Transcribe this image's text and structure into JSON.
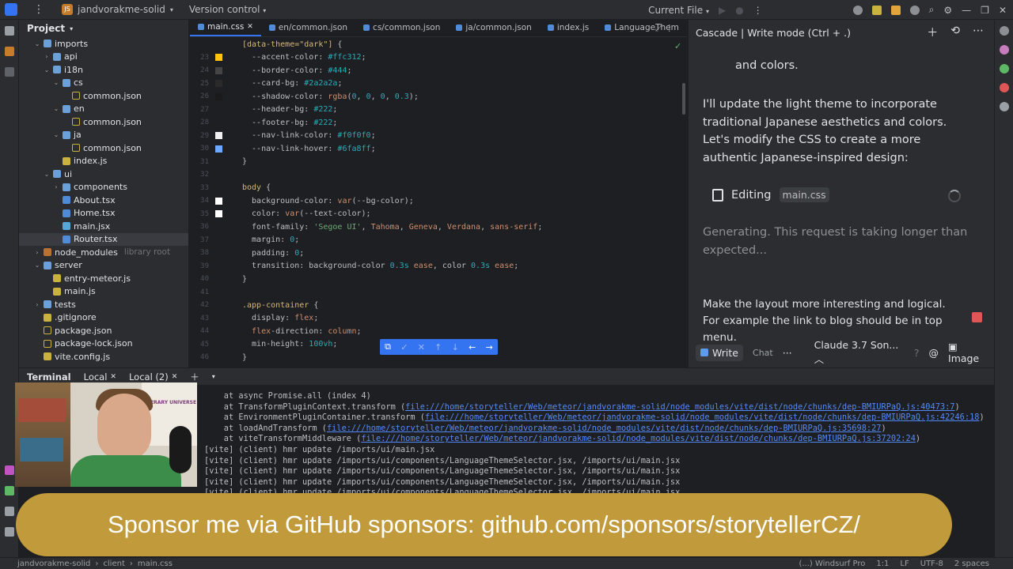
{
  "titlebar": {
    "project_name": "jandvorakme-solid",
    "version_control": "Version control",
    "current_file": "Current File"
  },
  "project_panel": {
    "title": "Project",
    "items": [
      {
        "label": "imports",
        "indent": 0,
        "kind": "folder",
        "open": true
      },
      {
        "label": "api",
        "indent": 1,
        "kind": "folder",
        "open": false
      },
      {
        "label": "i18n",
        "indent": 1,
        "kind": "folder",
        "open": true
      },
      {
        "label": "cs",
        "indent": 2,
        "kind": "folder",
        "open": true
      },
      {
        "label": "common.json",
        "indent": 3,
        "kind": "json"
      },
      {
        "label": "en",
        "indent": 2,
        "kind": "folder",
        "open": true
      },
      {
        "label": "common.json",
        "indent": 3,
        "kind": "json"
      },
      {
        "label": "ja",
        "indent": 2,
        "kind": "folder",
        "open": true
      },
      {
        "label": "common.json",
        "indent": 3,
        "kind": "json"
      },
      {
        "label": "index.js",
        "indent": 2,
        "kind": "js"
      },
      {
        "label": "ui",
        "indent": 1,
        "kind": "folder",
        "open": true
      },
      {
        "label": "components",
        "indent": 2,
        "kind": "folder",
        "open": false
      },
      {
        "label": "About.tsx",
        "indent": 2,
        "kind": "tsx"
      },
      {
        "label": "Home.tsx",
        "indent": 2,
        "kind": "tsx"
      },
      {
        "label": "main.jsx",
        "indent": 2,
        "kind": "jsx"
      },
      {
        "label": "Router.tsx",
        "indent": 2,
        "kind": "tsx",
        "selected": true
      },
      {
        "label": "node_modules",
        "indent": 0,
        "kind": "orange",
        "open": false,
        "extra": "library root"
      },
      {
        "label": "server",
        "indent": 0,
        "kind": "folder",
        "open": true
      },
      {
        "label": "entry-meteor.js",
        "indent": 1,
        "kind": "js"
      },
      {
        "label": "main.js",
        "indent": 1,
        "kind": "js"
      },
      {
        "label": "tests",
        "indent": 0,
        "kind": "folder",
        "open": false
      },
      {
        "label": ".gitignore",
        "indent": 0,
        "kind": "js"
      },
      {
        "label": "package.json",
        "indent": 0,
        "kind": "json"
      },
      {
        "label": "package-lock.json",
        "indent": 0,
        "kind": "json"
      },
      {
        "label": "vite.config.js",
        "indent": 0,
        "kind": "js"
      }
    ]
  },
  "editor": {
    "tabs": [
      {
        "label": "main.css",
        "active": true
      },
      {
        "label": "en/common.json",
        "active": false
      },
      {
        "label": "cs/common.json",
        "active": false
      },
      {
        "label": "ja/common.json",
        "active": false
      },
      {
        "label": "index.js",
        "active": false
      },
      {
        "label": "LanguageThem",
        "active": false
      }
    ],
    "lines": [
      {
        "n": "",
        "code": "[data-theme=\"dark\"] {",
        "swatch": ""
      },
      {
        "n": "23",
        "code": "  --accent-color: #ffc312;",
        "swatch": "#ffc312"
      },
      {
        "n": "24",
        "code": "  --border-color: #444;",
        "swatch": "#444444"
      },
      {
        "n": "25",
        "code": "  --card-bg: #2a2a2a;",
        "swatch": "#2a2a2a"
      },
      {
        "n": "26",
        "code": "  --shadow-color: rgba(0, 0, 0, 0.3);",
        "swatch": "#1a1a1a"
      },
      {
        "n": "27",
        "code": "  --header-bg: #222;",
        "swatch": ""
      },
      {
        "n": "28",
        "code": "  --footer-bg: #222;",
        "swatch": ""
      },
      {
        "n": "29",
        "code": "  --nav-link-color: #f0f0f0;",
        "swatch": "#f0f0f0"
      },
      {
        "n": "30",
        "code": "  --nav-link-hover: #6fa8ff;",
        "swatch": "#6fa8ff"
      },
      {
        "n": "31",
        "code": "}",
        "swatch": ""
      },
      {
        "n": "32",
        "code": "",
        "swatch": ""
      },
      {
        "n": "33",
        "code": "body {",
        "swatch": ""
      },
      {
        "n": "34",
        "code": "  background-color: var(--bg-color);",
        "swatch": "#ffffff"
      },
      {
        "n": "35",
        "code": "  color: var(--text-color);",
        "swatch": "#ffffff"
      },
      {
        "n": "36",
        "code": "  font-family: 'Segoe UI', Tahoma, Geneva, Verdana, sans-serif;",
        "swatch": ""
      },
      {
        "n": "37",
        "code": "  margin: 0;",
        "swatch": ""
      },
      {
        "n": "38",
        "code": "  padding: 0;",
        "swatch": ""
      },
      {
        "n": "39",
        "code": "  transition: background-color 0.3s ease, color 0.3s ease;",
        "swatch": ""
      },
      {
        "n": "40",
        "code": "}",
        "swatch": ""
      },
      {
        "n": "41",
        "code": "",
        "swatch": ""
      },
      {
        "n": "42",
        "code": ".app-container {",
        "swatch": ""
      },
      {
        "n": "43",
        "code": "  display: flex;",
        "swatch": ""
      },
      {
        "n": "44",
        "code": "  flex-direction: column;",
        "swatch": ""
      },
      {
        "n": "45",
        "code": "  min-height: 100vh;",
        "swatch": ""
      },
      {
        "n": "46",
        "code": "}",
        "swatch": ""
      }
    ]
  },
  "cascade": {
    "header": "Cascade | Write mode (Ctrl + .)",
    "prev_tail": "and colors.",
    "message": "I'll update the light theme to incorporate traditional Japanese aesthetics and colors. Let's modify the CSS to create a more authentic Japanese-inspired design:",
    "editing_label": "Editing",
    "editing_file": "main.css",
    "generating": "Generating. This request is taking longer than expected...",
    "user_input": "Make the layout more interesting and logical. For example the link to blog should be in top menu.",
    "write": "Write",
    "chat": "Chat",
    "more": "···",
    "model": "Claude 3.7 Son...",
    "image": "Image"
  },
  "terminal": {
    "title": "Terminal",
    "tabs": [
      "Local",
      "Local (2)"
    ],
    "lines": [
      {
        "prefix": "    at async Promise.all (index 4)",
        "link": "",
        "suffix": ""
      },
      {
        "prefix": "    at TransformPluginContext.transform (",
        "link": "file:///home/storyteller/Web/meteor/jandvorakme-solid/node_modules/vite/dist/node/chunks/dep-BMIURPaQ.js:40473:7",
        "suffix": ")"
      },
      {
        "prefix": "    at EnvironmentPluginContainer.transform (",
        "link": "file:///home/storyteller/Web/meteor/jandvorakme-solid/node_modules/vite/dist/node/chunks/dep-BMIURPaQ.js:42246:18",
        "suffix": ")"
      },
      {
        "prefix": "    at loadAndTransform (",
        "link": "file:///home/storyteller/Web/meteor/jandvorakme-solid/node_modules/vite/dist/node/chunks/dep-BMIURPaQ.js:35698:27",
        "suffix": ")"
      },
      {
        "prefix": "    at viteTransformMiddleware (",
        "link": "file:///home/storyteller/Web/meteor/jandvorakme-solid/node_modules/vite/dist/node/chunks/dep-BMIURPaQ.js:37202:24",
        "suffix": ")"
      },
      {
        "prefix": "[vite] (client) hmr update /imports/ui/main.jsx",
        "link": "",
        "suffix": ""
      },
      {
        "prefix": "[vite] (client) hmr update /imports/ui/components/LanguageThemeSelector.jsx, /imports/ui/main.jsx",
        "link": "",
        "suffix": ""
      },
      {
        "prefix": "[vite] (client) hmr update /imports/ui/components/LanguageThemeSelector.jsx, /imports/ui/main.jsx",
        "link": "",
        "suffix": ""
      },
      {
        "prefix": "[vite] (client) hmr update /imports/ui/components/LanguageThemeSelector.jsx, /imports/ui/main.jsx",
        "link": "",
        "suffix": ""
      },
      {
        "prefix": "[vite] (client) hmr update /imports/ui/components/LanguageThemeSelector.jsx, /imports/ui/main.jsx",
        "link": "",
        "suffix": ""
      }
    ]
  },
  "webcam": {
    "poster_text": "LITERARY UNIVERSE"
  },
  "sponsor_banner": "Sponsor me via GitHub sponsors: github.com/sponsors/storytellerCZ/",
  "statusbar": {
    "crumbs": [
      "jandvorakme-solid",
      "client",
      "main.css"
    ],
    "right": [
      "(...) Windsurf Pro",
      "1:1",
      "LF",
      "UTF-8",
      "2 spaces"
    ]
  },
  "colors": {
    "accent": "#3574f0",
    "banner": "#c09a3b",
    "bg": "#1e1f22",
    "panel": "#2b2d30"
  }
}
